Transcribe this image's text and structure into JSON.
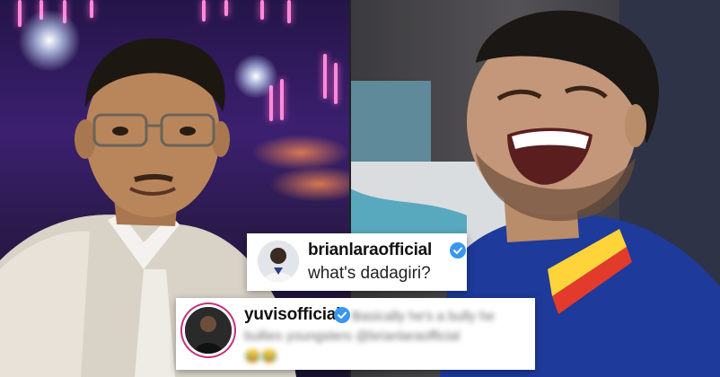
{
  "photos": {
    "left": {
      "description_icon": "man-with-glasses-selfie"
    },
    "right": {
      "description_icon": "laughing-man"
    }
  },
  "comment_1": {
    "username": "brianlaraofficial",
    "text": "what's dadagiri?",
    "verified": true,
    "avatar_icon": "profile-avatar-icon"
  },
  "comment_2": {
    "username": "yuvisofficial",
    "verified": true,
    "avatar_icon": "profile-avatar-icon",
    "blurred_text_1": "Basically he's a bully he",
    "blurred_text_2": "bullies youngsters @brianlaraofficial",
    "blurred_text_3": "😂😂"
  },
  "colors": {
    "verified_blue": "#3897f0",
    "story_ring": "#c6307a",
    "text_dark": "#111111"
  }
}
